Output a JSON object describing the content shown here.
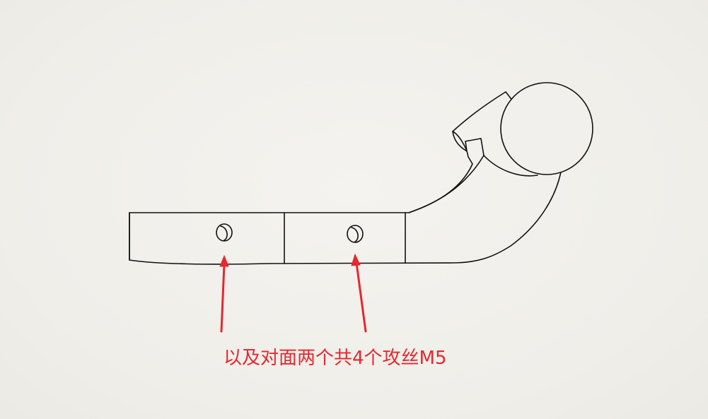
{
  "annotation": {
    "text": "以及对面两个共4个攻丝M5",
    "color": "#e8262e"
  },
  "drawing": {
    "line_color": "#111111",
    "arrow_color": "#e8262e"
  }
}
